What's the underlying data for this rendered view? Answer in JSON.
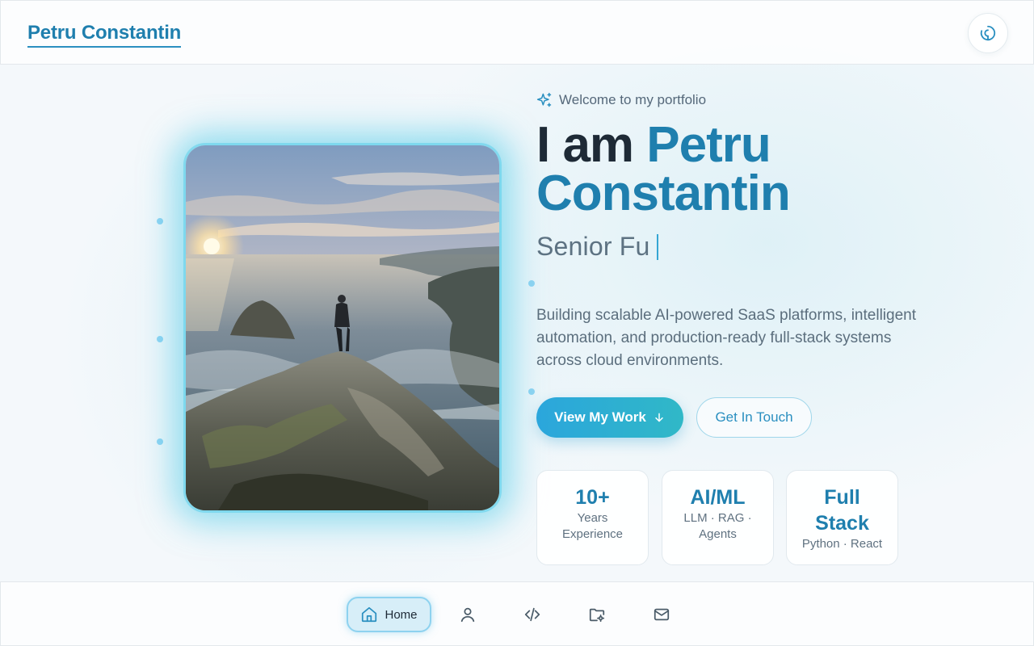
{
  "header": {
    "brand": "Petru Constantin",
    "theme_toggle_icon": "theme-toggle-icon"
  },
  "hero": {
    "photo_alt": "Person standing on a rocky cliff above the sea at sunset",
    "welcome": "Welcome to my portfolio",
    "welcome_icon": "sparkles-icon",
    "headline_prefix": "I am",
    "headline_name_1": "Petru",
    "headline_name_2": "Constantin",
    "role_typing": "Senior Fu",
    "description": "Building scalable AI-powered SaaS platforms, intelligent automation, and production-ready full-stack systems across cloud environments.",
    "primary_button": "View My Work",
    "secondary_button": "Get In Touch"
  },
  "stats": [
    {
      "value": "10+",
      "label_1": "Years",
      "label_2": "Experience"
    },
    {
      "value": "AI/ML",
      "label_1": "LLM · RAG ·",
      "label_2": "Agents"
    },
    {
      "value_1": "Full",
      "value_2": "Stack",
      "label_1": "Python · React"
    }
  ],
  "bottom_nav": {
    "items": [
      {
        "label": "Home",
        "icon": "home-icon",
        "active": true
      },
      {
        "label": "",
        "icon": "user-icon"
      },
      {
        "label": "",
        "icon": "code-icon"
      },
      {
        "label": "",
        "icon": "folder-icon"
      },
      {
        "label": "",
        "icon": "mail-icon"
      }
    ]
  },
  "colors": {
    "accent": "#1f7fae",
    "primary_gradient_start": "#2ba6dc",
    "primary_gradient_end": "#30b8c7",
    "text_dark": "#1e2a36",
    "text_muted": "#5b6e7d"
  }
}
